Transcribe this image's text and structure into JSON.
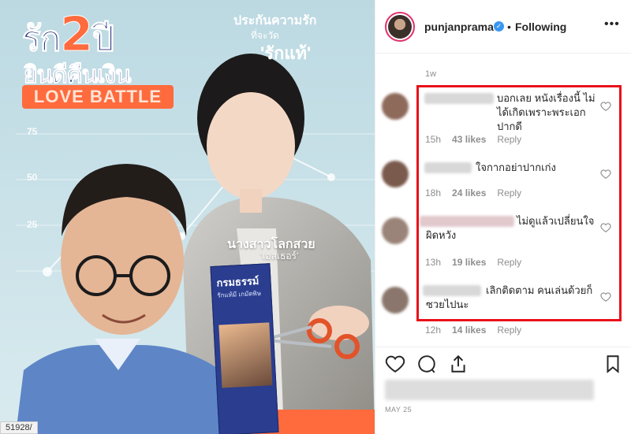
{
  "poster": {
    "title_line1_a": "รัก",
    "title_line1_b": "2",
    "title_line1_c": "ปี",
    "title_line2": "ยินดีคืนเงิน",
    "badge": "LOVE BATTLE",
    "tagline1": "ประกันความรัก",
    "tagline2": "ที่จะวัด",
    "tagline3": "'รักแท้'",
    "axis_ticks": [
      "75",
      "50",
      "25"
    ],
    "caption_name": "นางสาวโลกสวย",
    "caption_role": "'เอสเธอร์'",
    "brochure_title": "กรมธรรม์",
    "brochure_sub": "รักแท้มี เกมัดพิษ",
    "url_tip": "51928/"
  },
  "header": {
    "username": "punjanprama",
    "verified_icon": "verified-badge-icon",
    "separator": "•",
    "follow_status": "Following",
    "more": "•••"
  },
  "feed": {
    "top_time": "1w",
    "comments": [
      {
        "text": "บอกเลย หนังเรื่องนี้ ไม่ได้เกิดเพราะพระเอกปากดี",
        "time": "15h",
        "likes": "43 likes",
        "reply": "Reply"
      },
      {
        "text": "ใจกากอย่าปากเก่ง",
        "time": "18h",
        "likes": "24 likes",
        "reply": "Reply"
      },
      {
        "text": "ไม่ดูแล้วเปลี่ยนใจ ผิดหวัง",
        "time": "13h",
        "likes": "19 likes",
        "reply": "Reply"
      },
      {
        "text": "เลิกติดตาม คนเล่นด้วยก็ซวยไปนะ",
        "time": "12h",
        "likes": "14 likes",
        "reply": "Reply"
      }
    ]
  },
  "footer": {
    "date": "MAY 25"
  },
  "colors": {
    "highlight": "#e8101a",
    "verified": "#3897f0",
    "poster_navy": "#1d2a78",
    "poster_orange": "#ff6b3d"
  }
}
